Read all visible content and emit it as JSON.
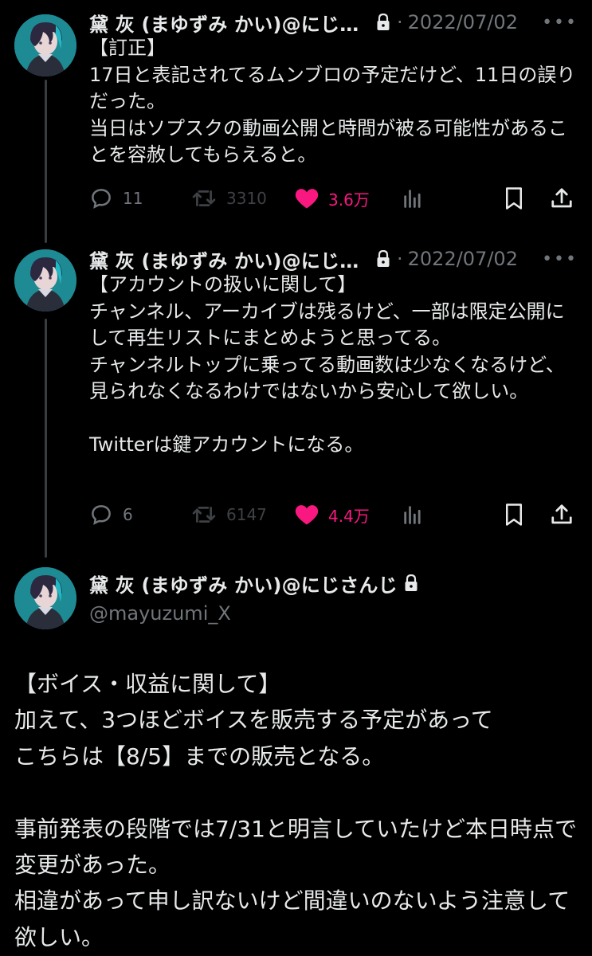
{
  "colors": {
    "background": "#000000",
    "text": "#e7e9ea",
    "muted": "#71767b",
    "like": "#f91880"
  },
  "tweet1": {
    "name": "黛 灰 (まゆずみ かい)@にじさ…",
    "date": "2022/07/02",
    "body": "【訂正】\n17日と表記されてるムンブロの予定だけど、11日の誤りだった。\n当日はソプスクの動画公開と時間が被る可能性があることを容赦してもらえると。",
    "replies": "11",
    "retweets": "3310",
    "likes": "3.6万"
  },
  "tweet2": {
    "name": "黛 灰 (まゆずみ かい)@にじさ…",
    "date": "2022/07/02",
    "body": "【アカウントの扱いに関して】\nチャンネル、アーカイブは残るけど、一部は限定公開にして再生リストにまとめようと思ってる。\nチャンネルトップに乗ってる動画数は少なくなるけど、見られなくなるわけではないから安心して欲しい。\n\nTwitterは鍵アカウントになる。",
    "replies": "6",
    "retweets": "6147",
    "likes": "4.4万"
  },
  "main": {
    "name": "黛 灰 (まゆずみ かい)@にじさんじ",
    "handle": "@mayuzumi_X",
    "body": "【ボイス・収益に関して】\n加えて、3つほどボイスを販売する予定があって\nこちらは【8/5】までの販売となる。\n\n事前発表の段階では7/31と明言していたけど本日時点で変更があった。\n相違があって申し訳ないけど間違いのないよう注意して欲しい。"
  },
  "icons": [
    "lock-icon",
    "more-icon",
    "reply-icon",
    "retweet-icon",
    "heart-icon",
    "views-icon",
    "bookmark-icon",
    "share-icon"
  ]
}
